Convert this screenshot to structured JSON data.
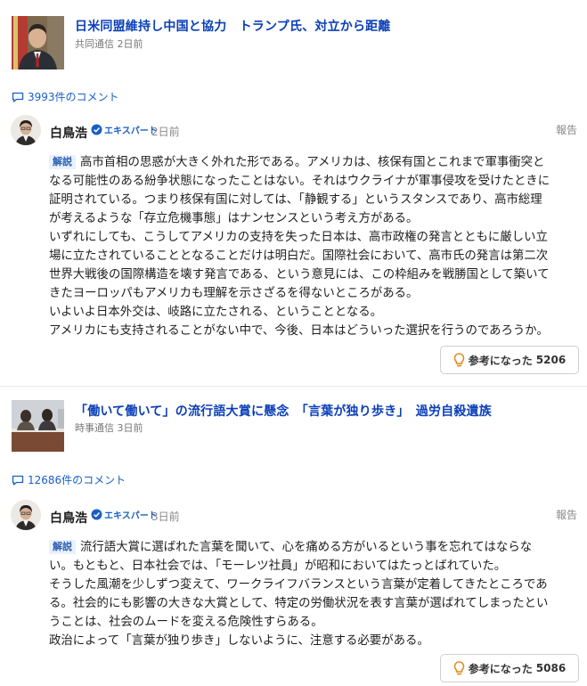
{
  "articles": [
    {
      "title": "日米同盟維持し中国と協力　トランプ氏、対立から距離",
      "source": "共同通信",
      "time": "2日前",
      "comment_count": "3993件のコメント",
      "comment": {
        "user": "白鳥浩",
        "badge": "エキスパート",
        "time": "2日前",
        "report": "報告",
        "tag": "解説",
        "lines": [
          "高市首相の思惑が大きく外れた形である。アメリカは、核保有国とこれまで軍事衝突と",
          "なる可能性のある紛争状態になったことはない。それはウクライナが軍事侵攻を受けたときに",
          "証明されている。つまり核保有国に対しては、「静観する」というスタンスであり、高市総理",
          "が考えるような「存立危機事態」はナンセンスという考え方がある。",
          "いずれにしても、こうしてアメリカの支持を失った日本は、高市政権の発言とともに厳しい立",
          "場に立たされていることとなることだけは明白だ。国際社会において、高市氏の発言は第二次",
          "世界大戦後の国際構造を壊す発言である、という意見には、この枠組みを戦勝国として築いて",
          "きたヨーロッパもアメリカも理解を示さざるを得ないところがある。",
          "いよいよ日本外交は、岐路に立たされる、ということとなる。",
          "アメリカにも支持されることがない中で、今後、日本はどういった選択を行うのであろうか。"
        ],
        "helpful_label": "参考になった",
        "helpful_count": "5206"
      }
    },
    {
      "title": "「働いて働いて」の流行語大賞に懸念　「言葉が独り歩き」　過労自殺遺族",
      "source": "時事通信",
      "time": "3日前",
      "comment_count": "12686件のコメント",
      "comment": {
        "user": "白鳥浩",
        "badge": "エキスパート",
        "time": "3日前",
        "report": "報告",
        "tag": "解説",
        "lines": [
          "流行語大賞に選ばれた言葉を聞いて、心を痛める方がいるという事を忘れてはならな",
          "い。もともと、日本社会では、「モーレツ社員」が昭和においてはたっとばれていた。",
          "そうした風潮を少しずつ変えて、ワークライフバランスという言葉が定着してきたところであ",
          "る。社会的にも影響の大きな大賞として、特定の労働状況を表す言葉が選ばれてしまったとい",
          "うことは、社会のムードを変える危険性すらある。",
          "政治によって「言葉が独り歩き」しないように、注意する必要がある。"
        ],
        "helpful_label": "参考になった",
        "helpful_count": "5086"
      }
    }
  ],
  "colors": {
    "link": "#0b3fb8",
    "accent": "#1a5fc4",
    "bulb": "#e08a1e"
  }
}
